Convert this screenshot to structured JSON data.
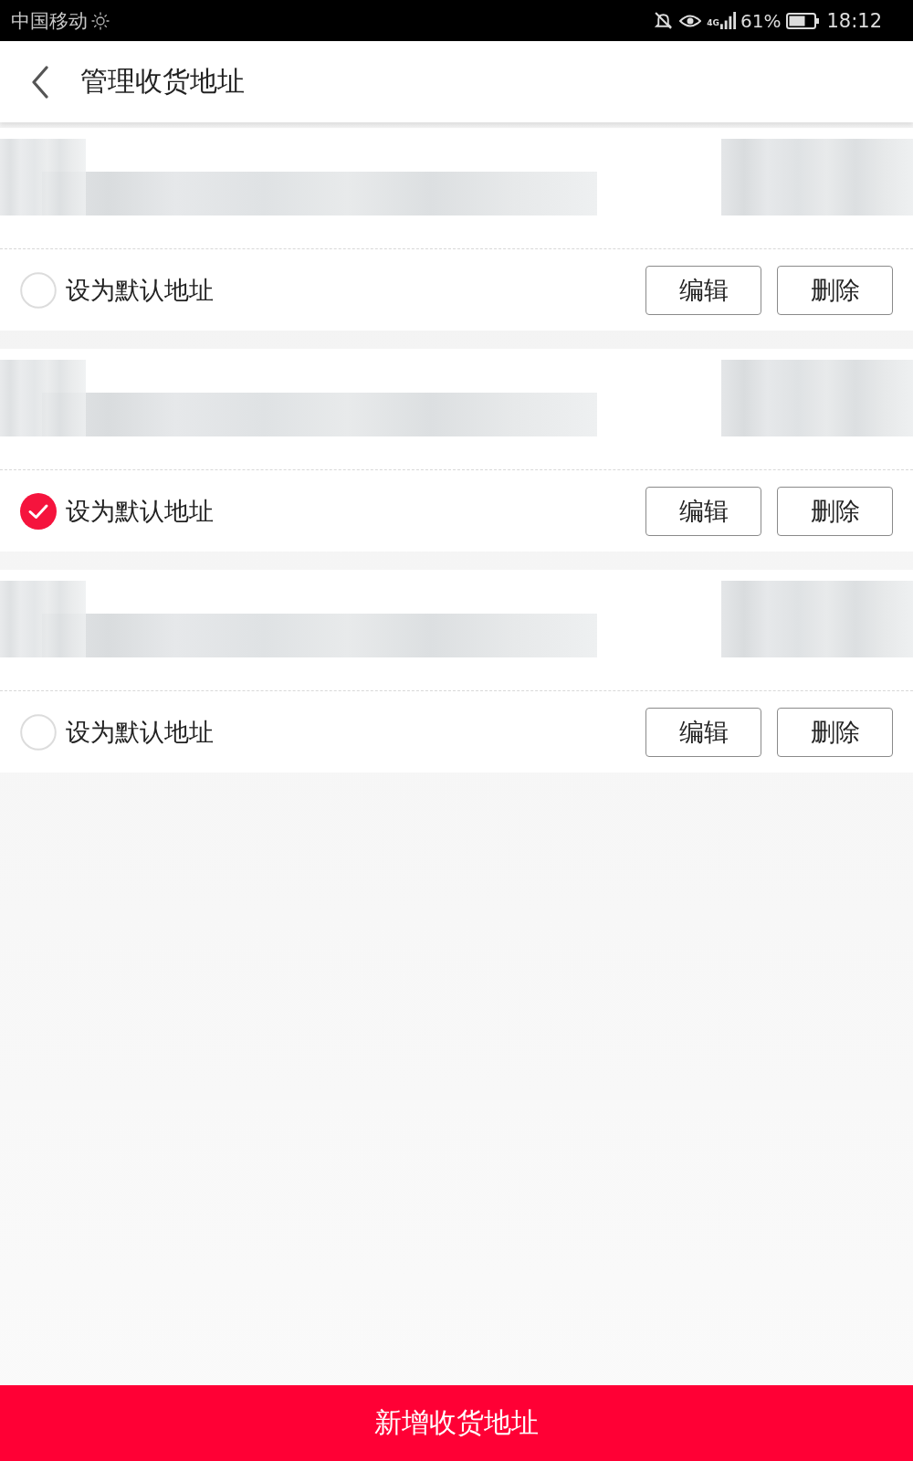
{
  "status_bar": {
    "carrier": "中国移动",
    "network": "4G",
    "battery": "61%",
    "time": "18:12"
  },
  "header": {
    "title": "管理收货地址"
  },
  "addresses": [
    {
      "default_label": "设为默认地址",
      "selected": false,
      "buttons": [
        "编辑",
        "删除"
      ]
    },
    {
      "default_label": "设为默认地址",
      "selected": true,
      "buttons": [
        "编辑",
        "删除"
      ]
    },
    {
      "default_label": "设为默认地址",
      "selected": false,
      "buttons": [
        "编辑",
        "删除"
      ]
    }
  ],
  "footer": {
    "button": "新增收货地址"
  }
}
